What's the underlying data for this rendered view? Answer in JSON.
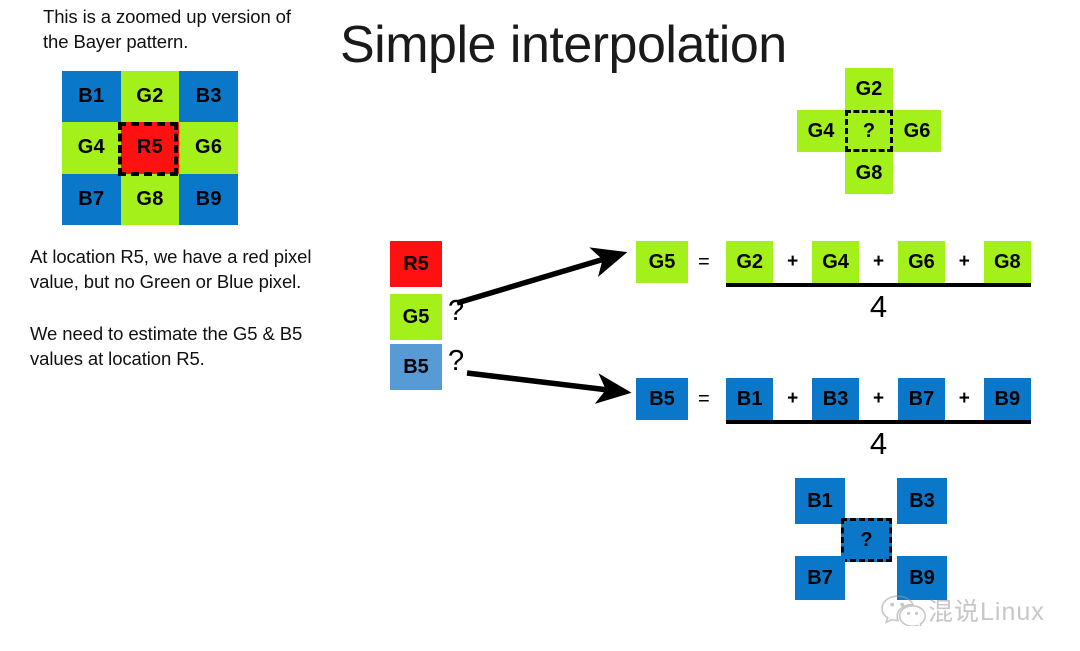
{
  "slide": {
    "title": "Simple interpolation",
    "intro_text": "This is a zoomed up version of the Bayer pattern.",
    "body_text_1": "At location R5, we have a red pixel value, but no Green or Blue pixel.",
    "body_text_2": "We need to estimate the G5 & B5 values at location R5."
  },
  "colors": {
    "blue": "#0B77C8",
    "blue_light": "#589BD4",
    "green": "#A4F01A",
    "red": "#FF1111",
    "black": "#000000",
    "white": "#FFFFFF"
  },
  "bayer_grid": {
    "cells": [
      {
        "label": "B1",
        "color": "blue"
      },
      {
        "label": "G2",
        "color": "green"
      },
      {
        "label": "B3",
        "color": "blue"
      },
      {
        "label": "G4",
        "color": "green"
      },
      {
        "label": "R5",
        "color": "red"
      },
      {
        "label": "G6",
        "color": "green"
      },
      {
        "label": "B7",
        "color": "blue"
      },
      {
        "label": "G8",
        "color": "green"
      },
      {
        "label": "B9",
        "color": "blue"
      }
    ],
    "highlighted_cell": "R5"
  },
  "green_cross": {
    "top": "G2",
    "left": "G4",
    "centre": "?",
    "right": "G6",
    "bottom": "G8"
  },
  "blue_cross": {
    "top_left": "B1",
    "top_right": "B3",
    "centre": "?",
    "bottom_left": "B7",
    "bottom_right": "B9"
  },
  "swatch_stack": {
    "r5": {
      "label": "R5",
      "question": ""
    },
    "g5": {
      "label": "G5",
      "question": "?"
    },
    "b5": {
      "label": "B5",
      "question": "?"
    }
  },
  "equations": [
    {
      "id": "green",
      "lhs": "G5",
      "equals": "=",
      "terms": [
        "G2",
        "G4",
        "G6",
        "G8"
      ],
      "operators": [
        "+",
        "+",
        "+"
      ],
      "denominator": "4"
    },
    {
      "id": "blue",
      "lhs": "B5",
      "equals": "=",
      "terms": [
        "B1",
        "B3",
        "B7",
        "B9"
      ],
      "operators": [
        "+",
        "+",
        "+"
      ],
      "denominator": "4"
    }
  ],
  "watermark": {
    "text": "混说Linux"
  }
}
